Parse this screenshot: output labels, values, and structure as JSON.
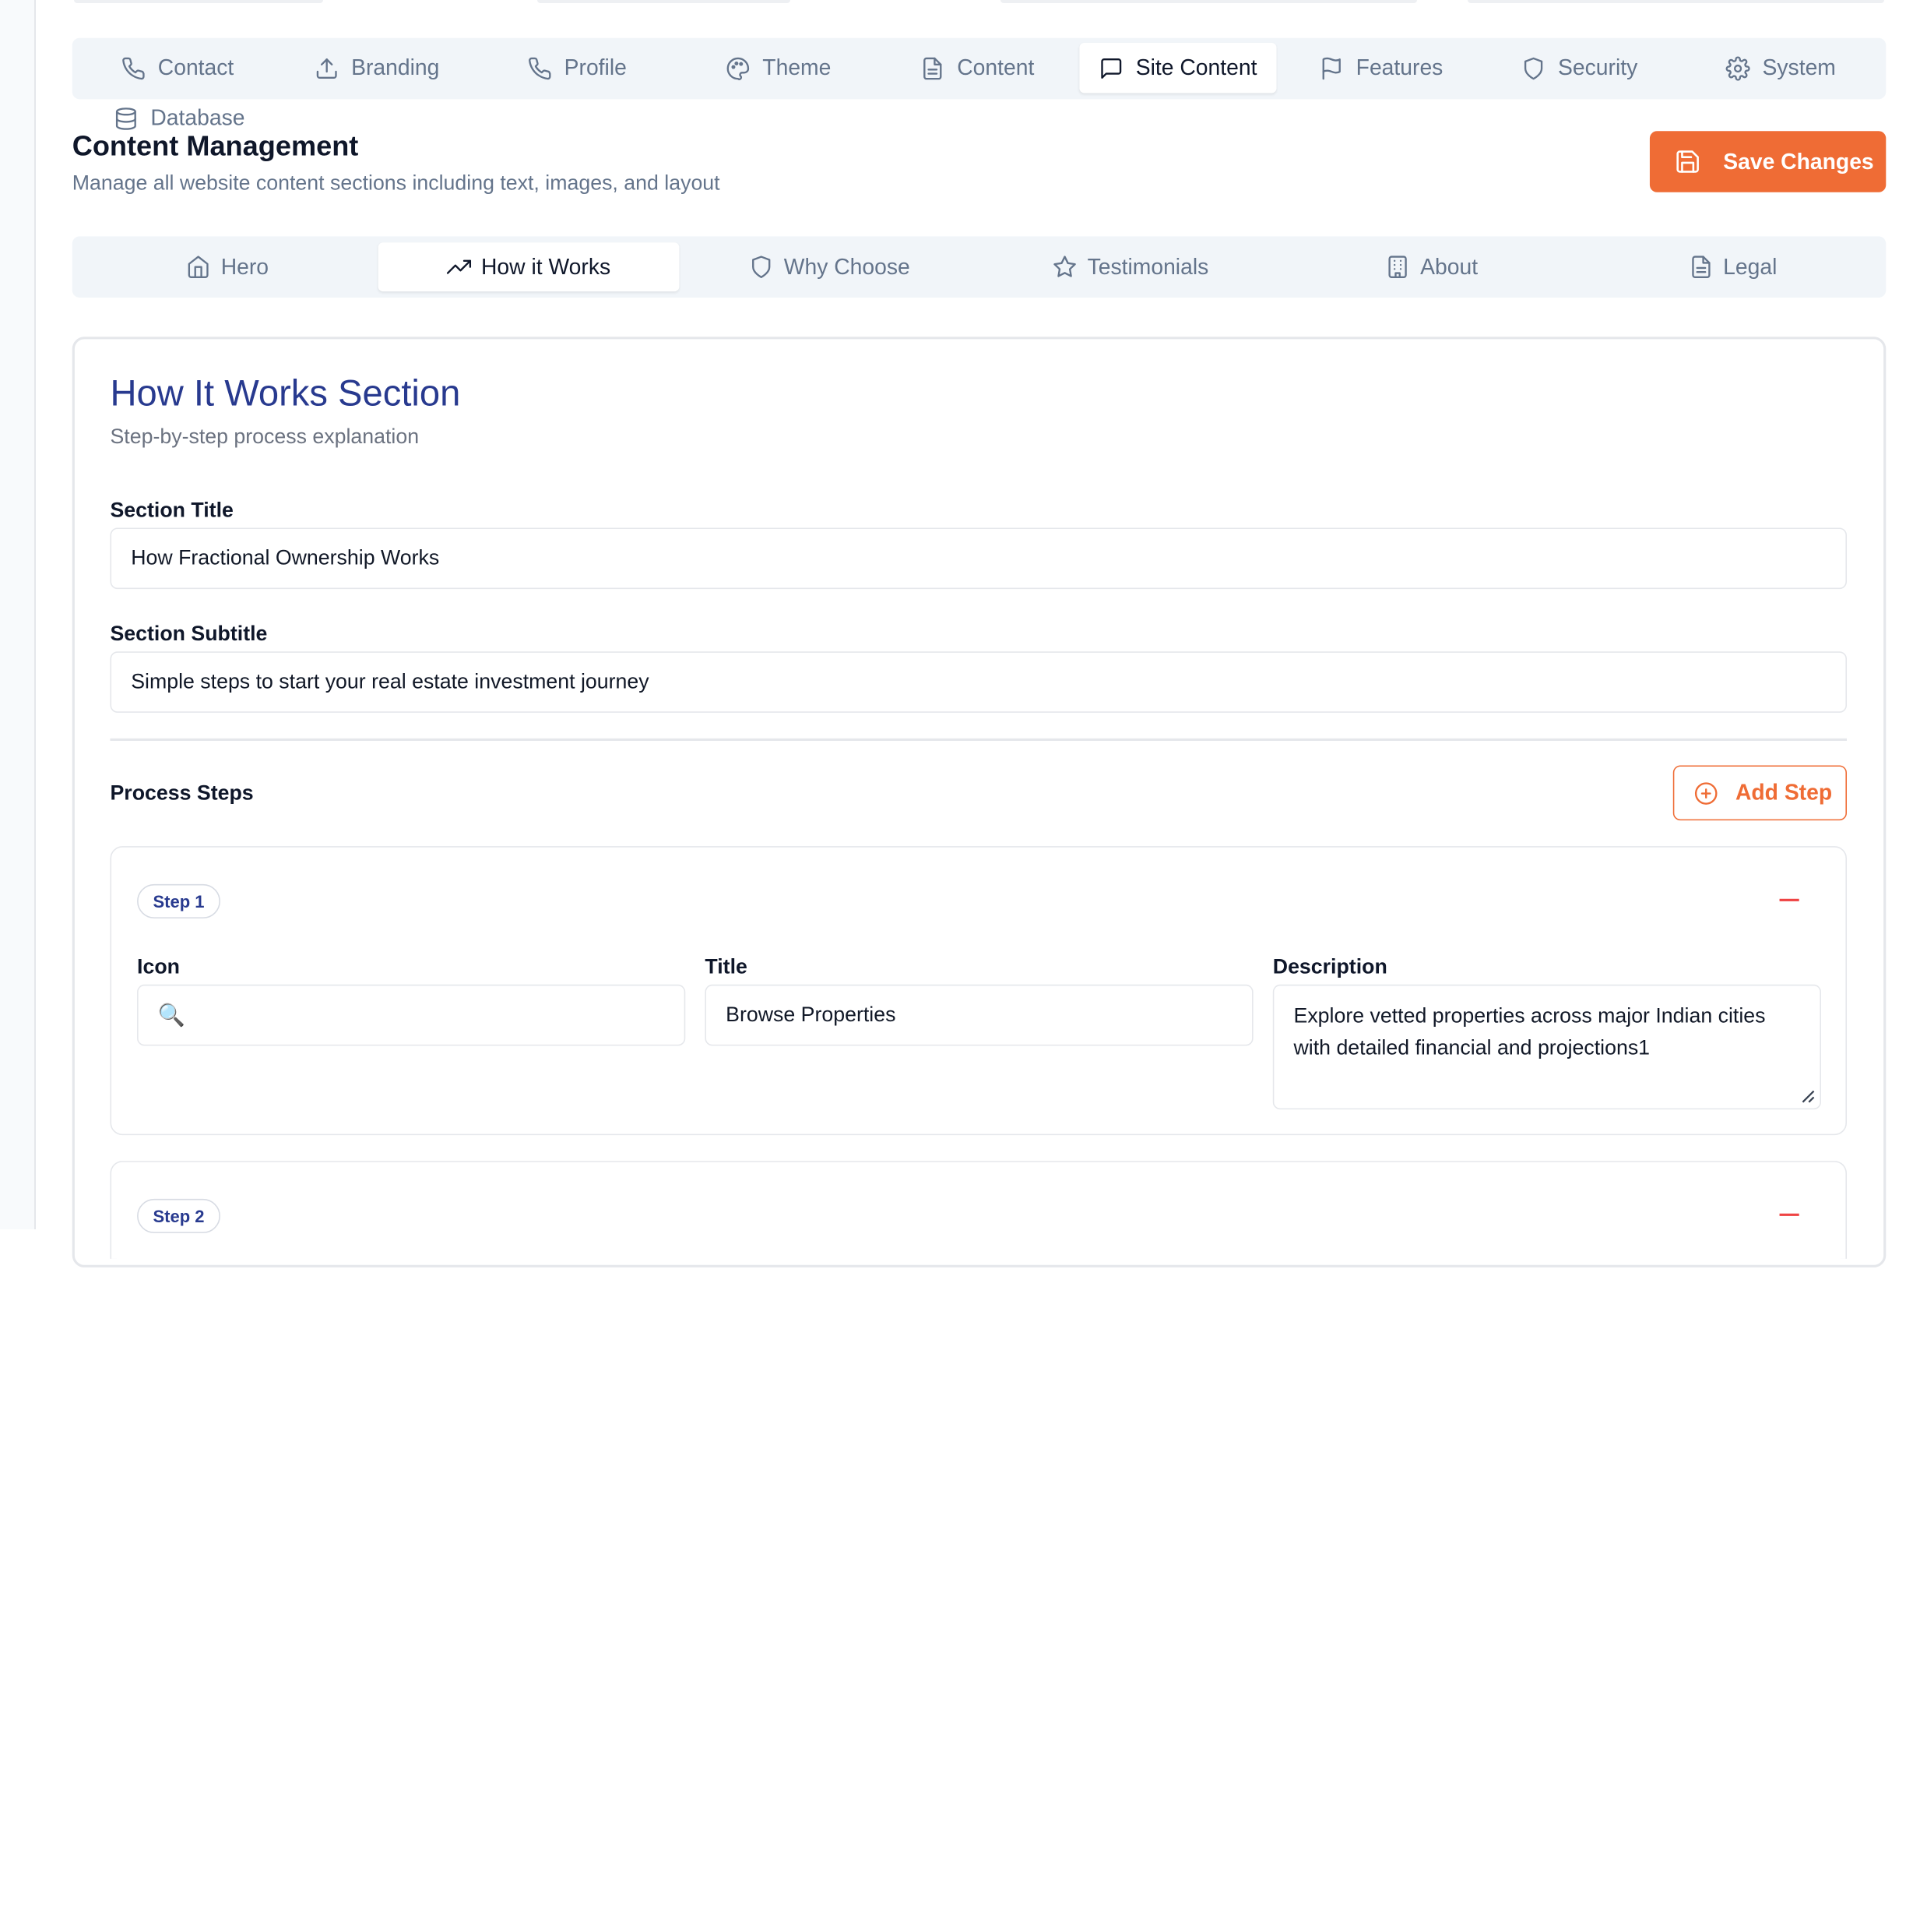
{
  "top_tabs": [
    {
      "label": "Contact",
      "icon": "phone-icon"
    },
    {
      "label": "Branding",
      "icon": "upload-icon"
    },
    {
      "label": "Profile",
      "icon": "phone-icon"
    },
    {
      "label": "Theme",
      "icon": "palette-icon"
    },
    {
      "label": "Content",
      "icon": "file-text-icon"
    },
    {
      "label": "Site Content",
      "icon": "message-square-icon",
      "active": true
    },
    {
      "label": "Features",
      "icon": "flag-icon"
    },
    {
      "label": "Security",
      "icon": "shield-icon"
    },
    {
      "label": "System",
      "icon": "gear-icon"
    },
    {
      "label": "Database",
      "icon": "database-icon"
    }
  ],
  "header": {
    "title": "Content Management",
    "subtitle": "Manage all website content sections including text, images, and layout",
    "save_label": "Save Changes"
  },
  "sub_tabs": [
    {
      "label": "Hero",
      "icon": "home-icon"
    },
    {
      "label": "How it Works",
      "icon": "trending-up-icon",
      "active": true
    },
    {
      "label": "Why Choose",
      "icon": "shield-icon"
    },
    {
      "label": "Testimonials",
      "icon": "star-icon"
    },
    {
      "label": "About",
      "icon": "building-icon"
    },
    {
      "label": "Legal",
      "icon": "file-text-icon"
    }
  ],
  "section": {
    "title": "How It Works Section",
    "description": "Step-by-step process explanation",
    "title_label": "Section Title",
    "title_value": "How Fractional Ownership Works",
    "subtitle_label": "Section Subtitle",
    "subtitle_value": "Simple steps to start your real estate investment journey",
    "steps_label": "Process Steps",
    "add_step_label": "Add Step"
  },
  "steps": [
    {
      "badge": "Step 1",
      "icon_label": "Icon",
      "icon_value": "🔍",
      "title_label": "Title",
      "title_value": "Browse Properties",
      "description_label": "Description",
      "description_value": "Explore vetted properties across major Indian cities with detailed financial and projections1"
    },
    {
      "badge": "Step 2"
    }
  ],
  "colors": {
    "accent": "#ef6c35",
    "section_title": "#283a8f",
    "remove": "#ef4444"
  }
}
